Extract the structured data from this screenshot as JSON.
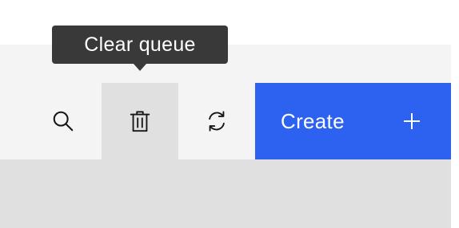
{
  "tooltip": {
    "text": "Clear queue"
  },
  "toolbar": {
    "search_icon": "search-icon",
    "trash_icon": "trash-icon",
    "refresh_icon": "refresh-icon",
    "create_label": "Create",
    "create_icon": "plus-icon"
  },
  "colors": {
    "primary_button": "#2c62ef",
    "toolbar_bg": "#f4f4f4",
    "active_tool_bg": "#e0e0e0",
    "tooltip_bg": "#393939"
  }
}
